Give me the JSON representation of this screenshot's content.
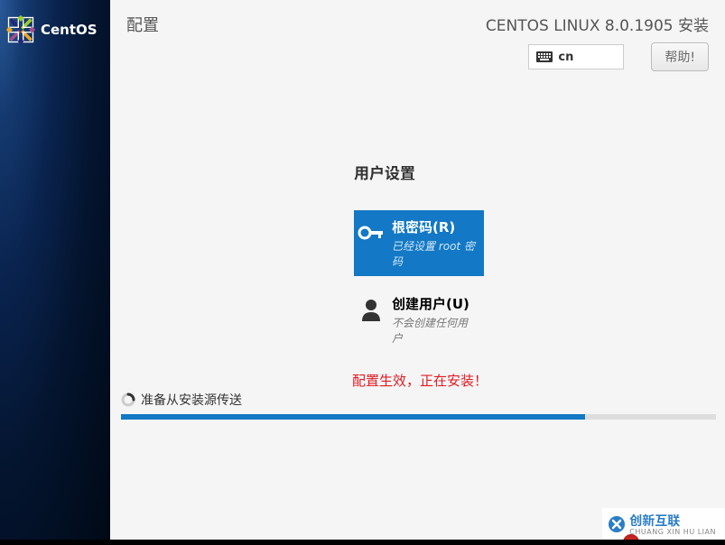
{
  "sidebar": {
    "brand": "CentOS"
  },
  "header": {
    "page_title": "配置",
    "installer_title": "CENTOS LINUX 8.0.1905 安装",
    "lang_code": "cn",
    "help_label": "帮助!"
  },
  "user_settings": {
    "heading": "用户设置",
    "root_password": {
      "title": "根密码(R)",
      "desc": "已经设置 root 密码"
    },
    "create_user": {
      "title": "创建用户(U)",
      "desc": "不会创建任何用户"
    }
  },
  "status": {
    "message": "配置生效，正在安装！"
  },
  "progress": {
    "label": "准备从安装源传送",
    "percent": 78
  },
  "watermark": {
    "text": "创新互联",
    "sub": "CHUANG XIN HU LIAN"
  }
}
